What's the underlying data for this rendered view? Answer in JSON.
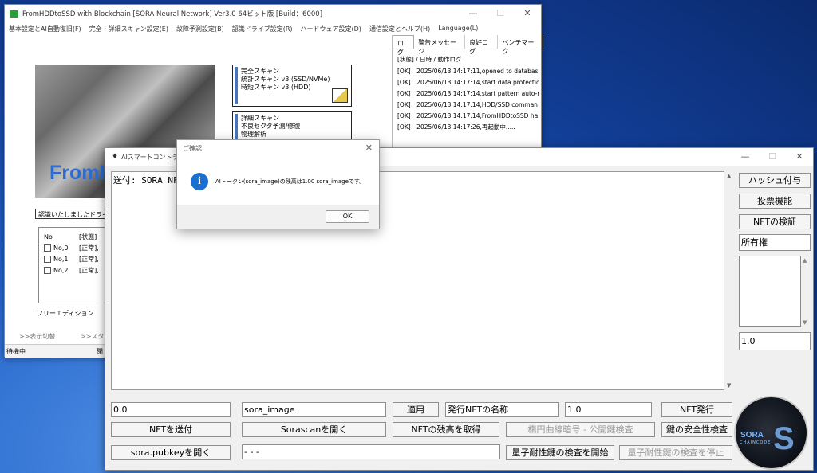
{
  "main_window": {
    "title": "FromHDDtoSSD with Blockchain [SORA Neural Network] Ver3.0 64ビット版 [Build：6000]",
    "controls": {
      "minimize": "—",
      "maximize": "☐",
      "close": "✕"
    },
    "menu": [
      "基本設定とAI自動復旧(F)",
      "完全・詳細スキャン設定(E)",
      "故障予測設定(B)",
      "認識ドライブ設定(R)",
      "ハードウェア設定(D)",
      "通信設定とヘルプ(H)",
      "Language(L)"
    ],
    "tabs": [
      "ログ",
      "警告メッセージ",
      "良好ログ",
      "ベンチマーク"
    ],
    "log_header": "[状態] / 日時 / 動作ログ",
    "log_lines": [
      "[OK]：2025/06/13 14:17:11,opened to databas",
      "[OK]：2025/06/13 14:17:14,start data protectic",
      "[OK]：2025/06/13 14:17:14,start pattern auto-r",
      "[OK]：2025/06/13 14:17:14,HDD/SSD comman",
      "[OK]：2025/06/13 14:17:14,FromHDDtoSSD ha",
      "[OK]：2025/06/13 14:17:26,再起動中....."
    ],
    "brand_text": "FromH",
    "scan_box1": [
      "完全スキャン",
      "統計スキャン v3 (SSD/NVMe)",
      "時短スキャン v3 (HDD)"
    ],
    "scan_box2": [
      "詳細スキャン",
      "不良セクタ予測/修復",
      "物理解析"
    ],
    "drive_label": "認識いたしましたドライ",
    "drive_list_headers": [
      "No",
      "[状態]"
    ],
    "drive_rows": [
      {
        "no": "No,0",
        "status": "[正常],"
      },
      {
        "no": "No,1",
        "status": "[正常],"
      },
      {
        "no": "No,2",
        "status": "[正常],"
      }
    ],
    "edition": "フリーエディション",
    "view_toggle": ">>表示切替",
    "start_label": ">>スタ",
    "status": "待機中",
    "status2": "閉"
  },
  "ai_window": {
    "title": "AIスマートコントラク",
    "controls": {
      "minimize": "—",
      "maximize": "☐",
      "close": "✕"
    },
    "textarea_text": "送付: SORA NF",
    "side_buttons": {
      "hash": "ハッシュ付与",
      "vote": "投票機能",
      "verify": "NFTの検証"
    },
    "ownership_field": "所有権",
    "ratio_field": "1.0",
    "row1": {
      "amount": "0.0",
      "token_name": "sora_image",
      "apply": "適用",
      "nft_name": "発行NFTの名称",
      "nft_qty": "1.0",
      "issue": "NFT発行"
    },
    "row2": {
      "send": "NFTを送付",
      "sorascan": "Sorascanを開く",
      "balance": "NFTの残高を取得",
      "ecc": "楕円曲線暗号 - 公開鍵検査",
      "keycheck": "鍵の安全性検査"
    },
    "row3": {
      "pubkey": "sora.pubkeyを開く",
      "pubkey_field": "- - -",
      "quantum_start": "量子耐性鍵の検査を開始",
      "quantum_stop": "量子耐性鍵の検査を停止"
    },
    "badge": {
      "brand": "SORA",
      "sub": "CHAINCODE",
      "letter": "S"
    }
  },
  "dialog": {
    "title": "ご確認",
    "close": "✕",
    "message": "AIトークン(sora_image)の残高は1.00 sora_imageです。",
    "ok_label": "OK",
    "info_glyph": "i"
  }
}
